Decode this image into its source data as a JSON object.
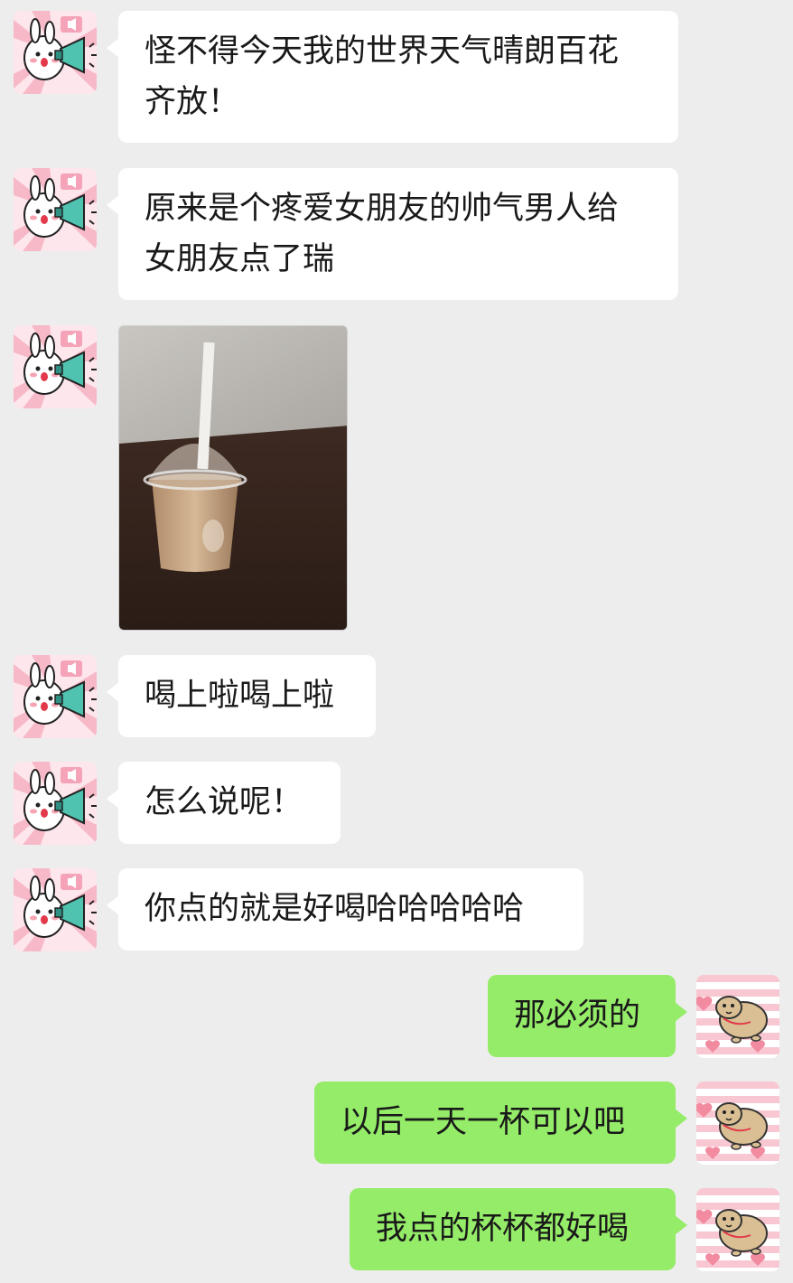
{
  "colors": {
    "background": "#ededed",
    "incoming_bubble": "#ffffff",
    "outgoing_bubble": "#95ec69",
    "text": "#191919"
  },
  "messages": [
    {
      "side": "left",
      "type": "text",
      "text": "怪不得今天我的世界天气晴朗百花\n齐放！"
    },
    {
      "side": "left",
      "type": "text",
      "text": "原来是个疼爱女朋友的帅气男人给\n女朋友点了瑞"
    },
    {
      "side": "left",
      "type": "image",
      "content": "iced coffee with straw on wooden table"
    },
    {
      "side": "left",
      "type": "text",
      "text": "喝上啦喝上啦"
    },
    {
      "side": "left",
      "type": "text",
      "text": "怎么说呢！"
    },
    {
      "side": "left",
      "type": "text",
      "text": "你点的就是好喝哈哈哈哈哈"
    },
    {
      "side": "right",
      "type": "text",
      "text": "那必须的"
    },
    {
      "side": "right",
      "type": "text",
      "text": "以后一天一杯可以吧"
    },
    {
      "side": "right",
      "type": "text",
      "text": "我点的杯杯都好喝"
    }
  ],
  "avatars": {
    "left": "bunny-megaphone-sticker-icon",
    "right": "hamster-hearts-sticker-icon"
  }
}
